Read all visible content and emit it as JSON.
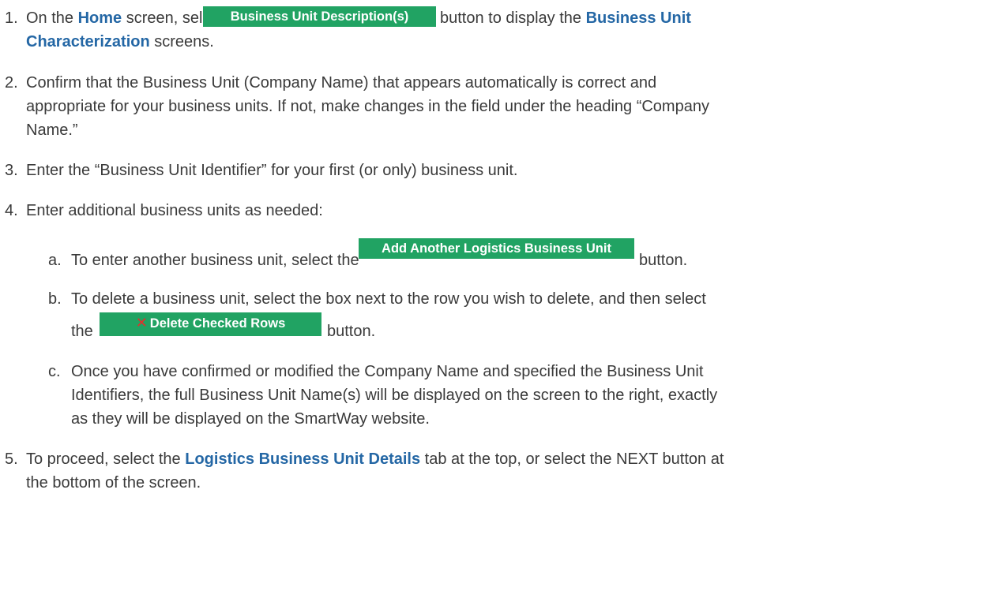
{
  "steps": {
    "s1": {
      "num": "1.",
      "pre": "On the ",
      "home": "Home",
      "mid": " screen, select the ",
      "button": "Business Unit Description(s)",
      "post": " button to display the ",
      "hl1": "Business Unit",
      "hl2": "Characterization",
      "end": " screens."
    },
    "s2": {
      "num": "2.",
      "line1": "Confirm that the Business Unit (Company Name) that appears automatically is correct and",
      "line2": "appropriate for your business units.  If not, make changes in the field under the heading “Company",
      "line3": "Name.”"
    },
    "s3": {
      "num": "3.",
      "text": "Enter the “Business Unit Identifier” for your first (or only) business unit."
    },
    "s4": {
      "num": "4.",
      "text": "Enter additional business units as needed:",
      "a": {
        "letter": "a.",
        "pre": "To enter another business unit, select the",
        "button": "Add Another Logistics Business Unit",
        "post": "button."
      },
      "b": {
        "letter": "b.",
        "line1": "To delete a business unit, select the box next to the row you wish to delete, and then select",
        "the": "the",
        "button": "Delete Checked Rows",
        "button_icon": "✕",
        "post": "button."
      },
      "c": {
        "letter": "c.",
        "line1": "Once you have confirmed or modified the Company Name and specified the Business Unit",
        "line2": "Identifiers, the full Business Unit Name(s) will be displayed on the screen to the right, exactly",
        "line3": "as they will be displayed on the SmartWay website."
      }
    },
    "s5": {
      "num": "5.",
      "pre": "To proceed, select the ",
      "hl": "Logistics Business Unit Details",
      "post": " tab at the top, or select the NEXT button at",
      "line2": "the bottom of the screen."
    }
  },
  "colors": {
    "text": "#3a3a3a",
    "highlight": "#2467a5",
    "button_bg": "#21a363",
    "button_text": "#ffffff",
    "delete_icon": "#e0312d"
  }
}
